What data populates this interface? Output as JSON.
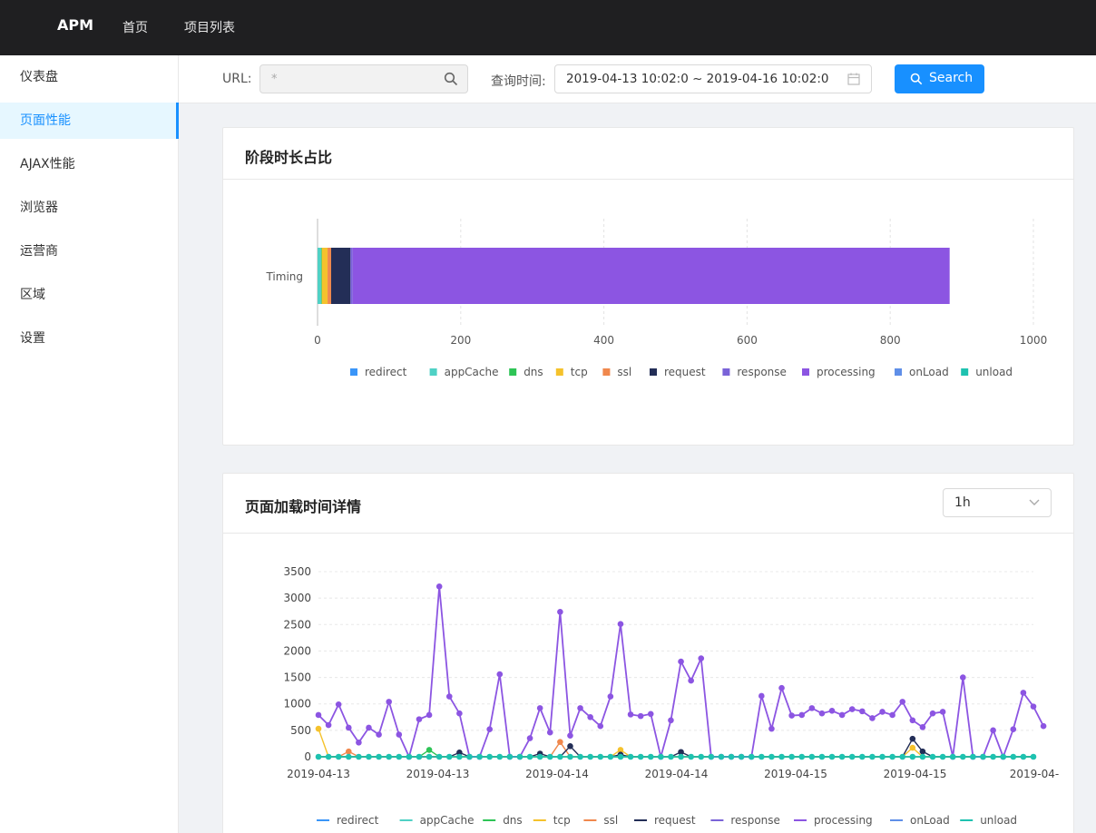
{
  "header": {
    "logo": "APM",
    "nav": [
      "首页",
      "项目列表"
    ]
  },
  "sidebar": {
    "items": [
      "仪表盘",
      "页面性能",
      "AJAX性能",
      "浏览器",
      "运营商",
      "区域",
      "设置"
    ],
    "active": 1
  },
  "filter": {
    "url_label": "URL:",
    "url_placeholder": "*",
    "time_label": "查询时间:",
    "date_range": "2019-04-13 10:02:0 ~ 2019-04-16 10:02:0",
    "search_button": "Search"
  },
  "colors": {
    "accent": "#1890ff",
    "topbar": "#1f1f21",
    "sidebar_active_bg": "#e6f7ff"
  },
  "legend": [
    {
      "name": "redirect",
      "color": "#3a95f8"
    },
    {
      "name": "appCache",
      "color": "#4fd1c5"
    },
    {
      "name": "dns",
      "color": "#2ec456"
    },
    {
      "name": "tcp",
      "color": "#f5c22c"
    },
    {
      "name": "ssl",
      "color": "#f0884d"
    },
    {
      "name": "request",
      "color": "#232e57"
    },
    {
      "name": "response",
      "color": "#7a63d8"
    },
    {
      "name": "processing",
      "color": "#8c55e2"
    },
    {
      "name": "onLoad",
      "color": "#5f8fe8"
    },
    {
      "name": "unload",
      "color": "#1ec2b0"
    }
  ],
  "stage_card": {
    "title": "阶段时长占比"
  },
  "load_card": {
    "title": "页面加载时间详情",
    "interval": "1h"
  },
  "chart_data": [
    {
      "type": "bar",
      "orientation": "horizontal",
      "stacked": true,
      "categories": [
        "Timing"
      ],
      "series": [
        {
          "name": "redirect",
          "values": [
            0
          ]
        },
        {
          "name": "appCache",
          "values": [
            5
          ]
        },
        {
          "name": "dns",
          "values": [
            1
          ]
        },
        {
          "name": "tcp",
          "values": [
            8
          ]
        },
        {
          "name": "ssl",
          "values": [
            5
          ]
        },
        {
          "name": "request",
          "values": [
            27
          ]
        },
        {
          "name": "response",
          "values": [
            3
          ]
        },
        {
          "name": "processing",
          "values": [
            834
          ]
        },
        {
          "name": "onLoad",
          "values": [
            0
          ]
        },
        {
          "name": "unload",
          "values": [
            0
          ]
        }
      ],
      "xlim": [
        0,
        1000
      ],
      "xticks": [
        0,
        200,
        400,
        600,
        800,
        1000
      ],
      "grid": true,
      "legend_position": "bottom"
    },
    {
      "type": "line",
      "x_tick_labels": [
        "2019-04-13",
        "2019-04-13",
        "2019-04-14",
        "2019-04-14",
        "2019-04-15",
        "2019-04-15",
        "2019-04-"
      ],
      "ylim": [
        0,
        3500
      ],
      "yticks": [
        0,
        500,
        1000,
        1500,
        2000,
        2500,
        3000,
        3500
      ],
      "grid": true,
      "legend_position": "bottom",
      "n_points": 72,
      "series": [
        {
          "name": "processing",
          "values": [
            790,
            600,
            990,
            550,
            270,
            550,
            420,
            1040,
            420,
            0,
            710,
            790,
            3220,
            1140,
            820,
            0,
            0,
            520,
            1560,
            0,
            0,
            350,
            920,
            460,
            2740,
            400,
            920,
            750,
            580,
            1140,
            2510,
            800,
            770,
            810,
            0,
            690,
            1800,
            1440,
            1860,
            0,
            0,
            0,
            0,
            0,
            1150,
            530,
            1300,
            780,
            790,
            920,
            820,
            870,
            790,
            900,
            860,
            730,
            850,
            790,
            1040,
            690,
            560,
            820,
            850,
            0,
            1500,
            0,
            0,
            500,
            0,
            520,
            1210,
            950,
            580
          ]
        },
        {
          "name": "tcp",
          "values": [
            530,
            0,
            0,
            0,
            0,
            0,
            0,
            0,
            0,
            0,
            0,
            0,
            0,
            0,
            0,
            0,
            0,
            0,
            0,
            0,
            0,
            0,
            0,
            0,
            0,
            0,
            0,
            0,
            0,
            0,
            130,
            0,
            0,
            0,
            0,
            0,
            0,
            0,
            0,
            0,
            0,
            0,
            0,
            0,
            0,
            0,
            0,
            0,
            0,
            0,
            0,
            0,
            0,
            0,
            0,
            0,
            0,
            0,
            0,
            170,
            0,
            0,
            0,
            0,
            0,
            0,
            0,
            0,
            0,
            0,
            0,
            0
          ]
        },
        {
          "name": "ssl",
          "values": [
            0,
            0,
            0,
            100,
            0,
            0,
            0,
            0,
            0,
            0,
            0,
            0,
            0,
            0,
            0,
            0,
            0,
            0,
            0,
            0,
            0,
            0,
            0,
            0,
            280,
            0,
            0,
            0,
            0,
            0,
            0,
            0,
            0,
            0,
            0,
            0,
            0,
            0,
            0,
            0,
            0,
            0,
            0,
            0,
            0,
            0,
            0,
            0,
            0,
            0,
            0,
            0,
            0,
            0,
            0,
            0,
            0,
            0,
            0,
            0,
            0,
            0,
            0,
            0,
            0,
            0,
            0,
            0,
            0,
            0,
            0,
            0
          ]
        },
        {
          "name": "request",
          "values": [
            0,
            0,
            0,
            0,
            0,
            0,
            0,
            0,
            0,
            0,
            0,
            0,
            0,
            0,
            80,
            0,
            0,
            0,
            0,
            0,
            0,
            0,
            60,
            0,
            0,
            200,
            0,
            0,
            0,
            0,
            40,
            0,
            0,
            0,
            0,
            0,
            90,
            0,
            0,
            0,
            0,
            0,
            0,
            0,
            0,
            0,
            0,
            0,
            0,
            0,
            0,
            0,
            0,
            0,
            0,
            0,
            0,
            0,
            0,
            340,
            100,
            0,
            0,
            0,
            0,
            0,
            0,
            0,
            0,
            0,
            0,
            0
          ]
        },
        {
          "name": "dns",
          "values": [
            0,
            0,
            0,
            0,
            0,
            0,
            0,
            0,
            0,
            0,
            0,
            130,
            0,
            0,
            0,
            0,
            0,
            0,
            0,
            0,
            0,
            0,
            0,
            0,
            0,
            0,
            0,
            0,
            0,
            0,
            0,
            0,
            0,
            0,
            0,
            0,
            0,
            0,
            0,
            0,
            0,
            0,
            0,
            0,
            0,
            0,
            0,
            0,
            0,
            0,
            0,
            0,
            0,
            0,
            0,
            0,
            0,
            0,
            0,
            0,
            0,
            0,
            0,
            0,
            0,
            0,
            0,
            0,
            0,
            0,
            0,
            0
          ]
        },
        {
          "name": "unload",
          "values": [
            0,
            0,
            0,
            0,
            0,
            0,
            0,
            0,
            0,
            0,
            0,
            0,
            0,
            0,
            0,
            0,
            0,
            0,
            0,
            0,
            0,
            0,
            0,
            0,
            0,
            0,
            0,
            0,
            0,
            0,
            0,
            0,
            0,
            0,
            0,
            0,
            0,
            0,
            0,
            0,
            0,
            0,
            0,
            0,
            0,
            0,
            0,
            0,
            0,
            0,
            0,
            0,
            0,
            0,
            0,
            0,
            0,
            0,
            0,
            0,
            0,
            0,
            0,
            0,
            0,
            0,
            0,
            0,
            0,
            0,
            0,
            0
          ]
        }
      ]
    }
  ]
}
